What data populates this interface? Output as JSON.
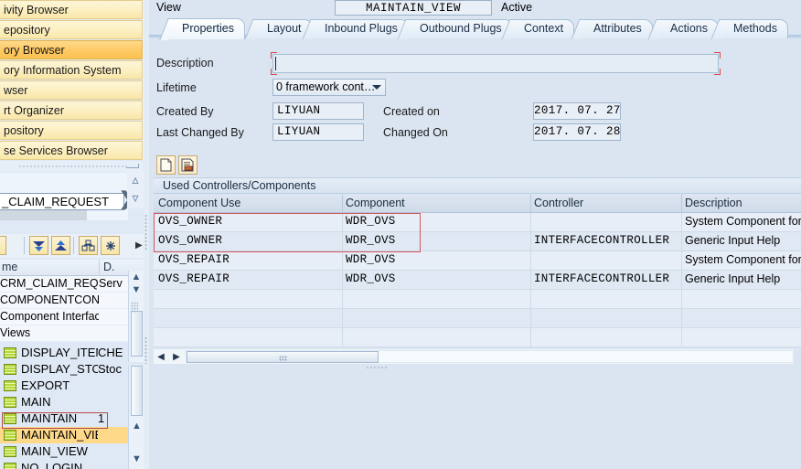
{
  "left_panel": {
    "nav_items": [
      {
        "label": "ivity Browser",
        "active": false
      },
      {
        "label": "epository",
        "active": false
      },
      {
        "label": "ory Browser",
        "active": true
      },
      {
        "label": "ory Information System",
        "active": false
      },
      {
        "label": "wser",
        "active": false
      },
      {
        "label": "rt Organizer",
        "active": false
      },
      {
        "label": "pository",
        "active": false
      },
      {
        "label": "se Services Browser",
        "active": false
      }
    ],
    "object_input": "_CLAIM_REQUEST",
    "chevron_icon": "chevron-right-icon",
    "scroll_up_icon": "caret-up-icon",
    "scroll_down_icon": "caret-down-icon",
    "toolbar_icons": [
      "filter-down-icon",
      "filter-up-icon",
      "hierarchy-icon",
      "asterisk-icon",
      "overflow-arrow-icon"
    ],
    "tree_table": {
      "columns": [
        "me",
        "D."
      ],
      "rows": [
        {
          "name": "CRM_CLAIM_REQUE",
          "d": "Serv"
        },
        {
          "name": "COMPONENTCONTR",
          "d": ""
        },
        {
          "name": "Component Interfac",
          "d": ""
        },
        {
          "name": "Views",
          "d": ""
        }
      ]
    },
    "tree_items": [
      {
        "label": "DISPLAY_ITEM_E",
        "col2": "CHE",
        "selected": false
      },
      {
        "label": "DISPLAY_STOCK",
        "col2": "Stoc",
        "selected": false
      },
      {
        "label": "EXPORT",
        "col2": "",
        "selected": false
      },
      {
        "label": "MAIN",
        "col2": "",
        "selected": false
      },
      {
        "label": "MAINTAIN",
        "col2": "1",
        "selected": false
      },
      {
        "label": "MAINTAIN_VIEW",
        "col2": "",
        "selected": true
      },
      {
        "label": "MAIN_VIEW",
        "col2": "",
        "selected": false
      },
      {
        "label": "NO_LOGIN",
        "col2": "",
        "selected": false
      }
    ]
  },
  "main": {
    "object_type_label": "View",
    "object_name": "MAINTAIN_VIEW",
    "status": "Active",
    "tabs": [
      {
        "label": "Properties",
        "selected": true
      },
      {
        "label": "Layout",
        "selected": false
      },
      {
        "label": "Inbound Plugs",
        "selected": false
      },
      {
        "label": "Outbound Plugs",
        "selected": false
      },
      {
        "label": "Context",
        "selected": false
      },
      {
        "label": "Attributes",
        "selected": false
      },
      {
        "label": "Actions",
        "selected": false
      },
      {
        "label": "Methods",
        "selected": false
      }
    ],
    "form": {
      "description_label": "Description",
      "description_value": "",
      "lifetime_label": "Lifetime",
      "lifetime_value": "0 framework cont…",
      "created_by_label": "Created By",
      "created_by_value": "LIYUAN",
      "created_on_label": "Created on",
      "created_on_value": "2017. 07. 27",
      "last_changed_by_label": "Last Changed By",
      "last_changed_by_value": "LIYUAN",
      "changed_on_label": "Changed On",
      "changed_on_value": "2017. 07. 28"
    },
    "table_toolbar_icons": [
      "new-document-icon",
      "copy-document-icon"
    ],
    "table": {
      "title": "Used Controllers/Components",
      "columns": [
        "Component Use",
        "Component",
        "Controller",
        "Description"
      ],
      "rows": [
        {
          "use": "OVS_OWNER",
          "component": "WDR_OVS",
          "controller": "",
          "description": "System Component for"
        },
        {
          "use": "OVS_OWNER",
          "component": "WDR_OVS",
          "controller": "INTERFACECONTROLLER",
          "description": "Generic Input Help"
        },
        {
          "use": "OVS_REPAIR",
          "component": "WDR_OVS",
          "controller": "",
          "description": "System Component for"
        },
        {
          "use": "OVS_REPAIR",
          "component": "WDR_OVS",
          "controller": "INTERFACECONTROLLER",
          "description": "Generic Input Help"
        },
        {
          "use": "",
          "component": "",
          "controller": "",
          "description": ""
        },
        {
          "use": "",
          "component": "",
          "controller": "",
          "description": ""
        },
        {
          "use": "",
          "component": "",
          "controller": "",
          "description": ""
        }
      ]
    },
    "hscroll": {
      "left_arrow_icon": "caret-left-icon",
      "right_arrow_icon": "caret-right-icon"
    }
  },
  "colors": {
    "window_bg": "#dbe5f1",
    "nav_item": "#fcefc0",
    "nav_item_active": "#fdc964",
    "selection_highlight": "#ffd98a",
    "focus_outline": "#d24a4a",
    "row_outline": "#d05a5a",
    "tab_selected": "#ffffff"
  }
}
